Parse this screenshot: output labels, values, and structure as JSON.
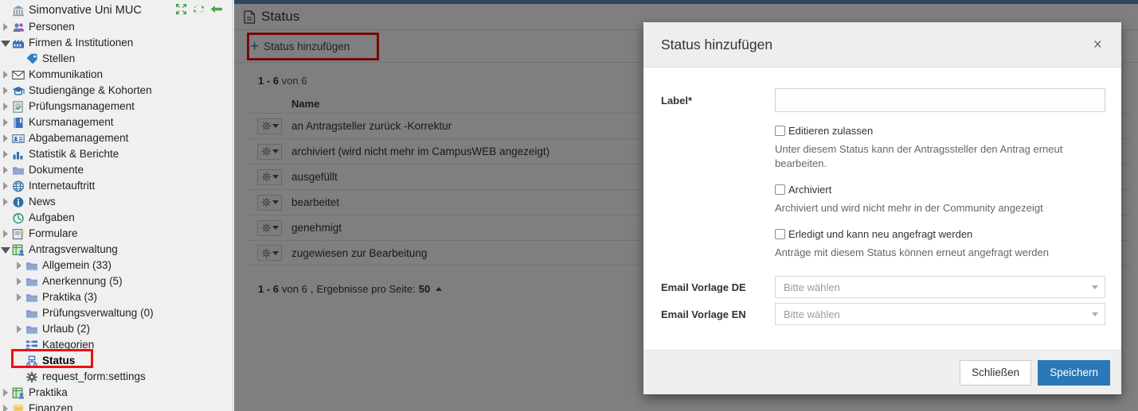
{
  "colors": {
    "accent": "#2a78b8",
    "topbar": "#5b8db8",
    "highlight": "#ee1111",
    "sidebar_bg": "#f0f0f0",
    "overlay": "rgba(0,0,0,0.5)"
  },
  "sidebar": {
    "root": {
      "label": "Simonvative Uni MUC",
      "icon": "bank-icon"
    },
    "root_actions": [
      {
        "name": "collapse-all-icon",
        "title": "collapse"
      },
      {
        "name": "refresh-icon",
        "title": "refresh"
      },
      {
        "name": "back-arrow-icon",
        "title": "back"
      }
    ],
    "items": [
      {
        "label": "Personen",
        "icon": "people-icon",
        "indent": 0,
        "twisty": "closed",
        "selected": false
      },
      {
        "label": "Firmen & Institutionen",
        "icon": "factory-icon",
        "indent": 0,
        "twisty": "open",
        "selected": false
      },
      {
        "label": "Stellen",
        "icon": "tag-icon",
        "indent": 1,
        "twisty": "none",
        "selected": false
      },
      {
        "label": "Kommunikation",
        "icon": "envelope-icon",
        "indent": 0,
        "twisty": "closed",
        "selected": false
      },
      {
        "label": "Studiengänge & Kohorten",
        "icon": "graduation-cap-icon",
        "indent": 0,
        "twisty": "closed",
        "selected": false
      },
      {
        "label": "Prüfungsmanagement",
        "icon": "exam-icon",
        "indent": 0,
        "twisty": "closed",
        "selected": false
      },
      {
        "label": "Kursmanagement",
        "icon": "book-icon",
        "indent": 0,
        "twisty": "closed",
        "selected": false
      },
      {
        "label": "Abgabemanagement",
        "icon": "card-icon",
        "indent": 0,
        "twisty": "closed",
        "selected": false
      },
      {
        "label": "Statistik & Berichte",
        "icon": "bar-chart-icon",
        "indent": 0,
        "twisty": "closed",
        "selected": false
      },
      {
        "label": "Dokumente",
        "icon": "folder-icon",
        "indent": 0,
        "twisty": "closed",
        "selected": false
      },
      {
        "label": "Internetauftritt",
        "icon": "globe-icon",
        "indent": 0,
        "twisty": "closed",
        "selected": false
      },
      {
        "label": "News",
        "icon": "info-icon",
        "indent": 0,
        "twisty": "closed",
        "selected": false
      },
      {
        "label": "Aufgaben",
        "icon": "clock-icon",
        "indent": 0,
        "twisty": "none",
        "selected": false
      },
      {
        "label": "Formulare",
        "icon": "form-icon",
        "indent": 0,
        "twisty": "closed",
        "selected": false
      },
      {
        "label": "Antragsverwaltung",
        "icon": "request-icon",
        "indent": 0,
        "twisty": "open",
        "selected": false
      },
      {
        "label": "Allgemein (33)",
        "icon": "folder-icon",
        "indent": 1,
        "twisty": "closed",
        "selected": false
      },
      {
        "label": "Anerkennung (5)",
        "icon": "folder-icon",
        "indent": 1,
        "twisty": "closed",
        "selected": false
      },
      {
        "label": "Praktika (3)",
        "icon": "folder-icon",
        "indent": 1,
        "twisty": "closed",
        "selected": false
      },
      {
        "label": "Prüfungsverwaltung (0)",
        "icon": "folder-icon",
        "indent": 1,
        "twisty": "none",
        "selected": false
      },
      {
        "label": "Urlaub (2)",
        "icon": "folder-icon",
        "indent": 1,
        "twisty": "closed",
        "selected": false
      },
      {
        "label": "Kategorien",
        "icon": "hierarchy-icon",
        "indent": 1,
        "twisty": "none",
        "selected": false
      },
      {
        "label": "Status",
        "icon": "sitemap-icon",
        "indent": 1,
        "twisty": "none",
        "selected": true
      },
      {
        "label": "request_form:settings",
        "icon": "gear-icon",
        "indent": 1,
        "twisty": "none",
        "selected": false
      },
      {
        "label": "Praktika",
        "icon": "request-icon",
        "indent": 0,
        "twisty": "closed",
        "selected": false
      },
      {
        "label": "Finanzen",
        "icon": "coins-icon",
        "indent": 0,
        "twisty": "closed",
        "selected": false
      }
    ]
  },
  "main": {
    "page_title": "Status",
    "page_icon": "document-icon",
    "toolbar": {
      "add_label": "Status hinzufügen",
      "add_icon": "plus-icon"
    },
    "count_top": {
      "range": "1 - 6",
      "of": "von 6"
    },
    "table": {
      "columns": [
        "Name"
      ],
      "rows": [
        {
          "name": "an Antragsteller zurück -Korrektur"
        },
        {
          "name": "archiviert (wird nicht mehr im CampusWEB angezeigt)"
        },
        {
          "name": "ausgefüllt"
        },
        {
          "name": "bearbeitet"
        },
        {
          "name": "genehmigt"
        },
        {
          "name": "zugewiesen zur Bearbeitung"
        }
      ]
    },
    "count_bottom": {
      "range": "1 - 6",
      "of": "von 6",
      "separator": ",",
      "per_page_label": "Ergebnisse pro Seite:",
      "per_page_value": "50"
    }
  },
  "modal": {
    "title": "Status hinzufügen",
    "close_icon": "close-icon",
    "close_label": "×",
    "fields": {
      "label": {
        "label": "Label*",
        "value": "",
        "placeholder": ""
      },
      "email_de": {
        "label": "Email Vorlage DE",
        "value": "Bitte wählen"
      },
      "email_en": {
        "label": "Email Vorlage EN",
        "value": "Bitte wählen"
      }
    },
    "checkboxes": [
      {
        "label": "Editieren zulassen",
        "checked": false,
        "description": "Unter diesem Status kann der Antragssteller den Antrag erneut bearbeiten."
      },
      {
        "label": "Archiviert",
        "checked": false,
        "description": "Archiviert und wird nicht mehr in der Community angezeigt"
      },
      {
        "label": "Erledigt und kann neu angefragt werden",
        "checked": false,
        "description": "Anträge mit diesem Status können erneut angefragt werden"
      }
    ],
    "buttons": {
      "close": "Schließen",
      "save": "Speichern"
    }
  }
}
